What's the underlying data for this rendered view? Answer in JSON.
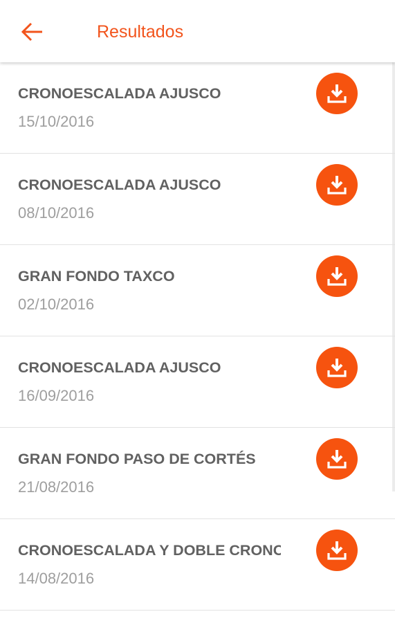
{
  "appbar": {
    "title": "Resultados",
    "back_icon": "arrow-left-icon"
  },
  "colors": {
    "accent": "#f2541c",
    "download_button": "#f6530f",
    "title_text": "#616161",
    "date_text": "#9e9e9e",
    "divider": "#e2e2e2"
  },
  "results": [
    {
      "title": "CRONOESCALADA AJUSCO",
      "date": "15/10/2016",
      "icon": "download-icon"
    },
    {
      "title": "CRONOESCALADA AJUSCO",
      "date": "08/10/2016",
      "icon": "download-icon"
    },
    {
      "title": "GRAN FONDO TAXCO",
      "date": "02/10/2016",
      "icon": "download-icon"
    },
    {
      "title": "CRONOESCALADA AJUSCO",
      "date": "16/09/2016",
      "icon": "download-icon"
    },
    {
      "title": "GRAN FONDO PASO DE CORTÉS",
      "date": "21/08/2016",
      "icon": "download-icon"
    },
    {
      "title": "CRONOESCALADA Y DOBLE CRONO",
      "date": "14/08/2016",
      "icon": "download-icon"
    }
  ]
}
